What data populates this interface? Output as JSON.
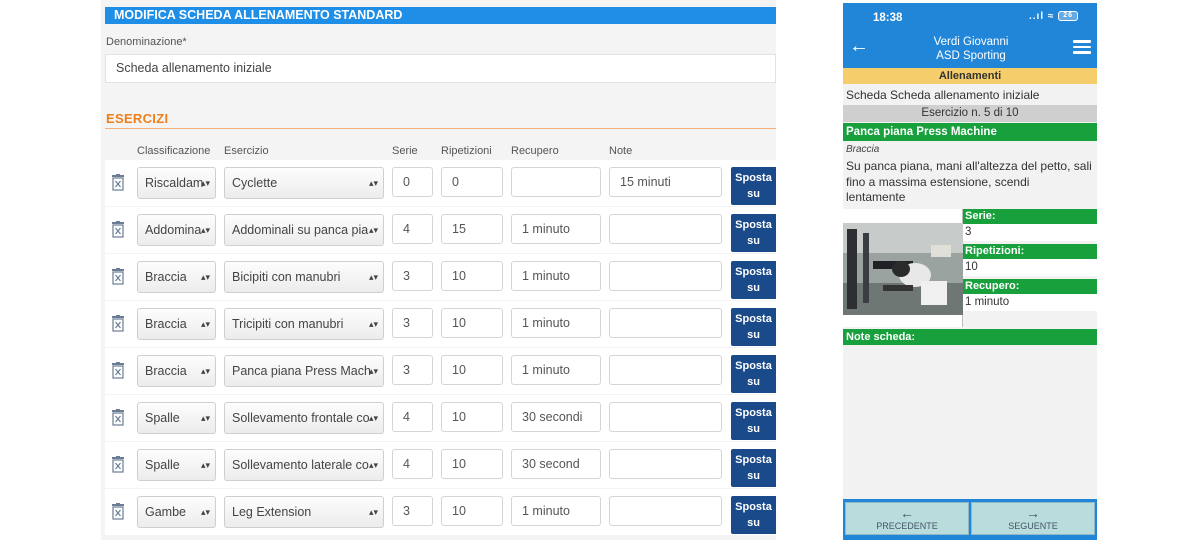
{
  "form": {
    "title": "MODIFICA SCHEDA ALLENAMENTO STANDARD",
    "name_label": "Denominazione*",
    "name_value": "Scheda allenamento iniziale",
    "section_title": "ESERCIZI",
    "columns": {
      "classification": "Classificazione",
      "exercise": "Esercizio",
      "sets": "Serie",
      "reps": "Ripetizioni",
      "rest": "Recupero",
      "notes": "Note"
    },
    "move_up_label_1": "Sposta",
    "move_up_label_2": "su",
    "rows": [
      {
        "classification": "Riscaldam",
        "exercise": "Cyclette",
        "sets": "0",
        "reps": "0",
        "rest": "",
        "notes": "15 minuti"
      },
      {
        "classification": "Addomina",
        "exercise": "Addominali su panca pia",
        "sets": "4",
        "reps": "15",
        "rest": "1 minuto",
        "notes": ""
      },
      {
        "classification": "Braccia",
        "exercise": "Bicipiti con manubri",
        "sets": "3",
        "reps": "10",
        "rest": "1 minuto",
        "notes": ""
      },
      {
        "classification": "Braccia",
        "exercise": "Tricipiti con manubri",
        "sets": "3",
        "reps": "10",
        "rest": "1 minuto",
        "notes": ""
      },
      {
        "classification": "Braccia",
        "exercise": "Panca piana Press Mach",
        "sets": "3",
        "reps": "10",
        "rest": "1 minuto",
        "notes": ""
      },
      {
        "classification": "Spalle",
        "exercise": "Sollevamento frontale co",
        "sets": "4",
        "reps": "10",
        "rest": "30 secondi",
        "notes": ""
      },
      {
        "classification": "Spalle",
        "exercise": "Sollevamento laterale co",
        "sets": "4",
        "reps": "10",
        "rest": "30 second",
        "notes": ""
      },
      {
        "classification": "Gambe",
        "exercise": "Leg Extension",
        "sets": "3",
        "reps": "10",
        "rest": "1 minuto",
        "notes": ""
      }
    ]
  },
  "phone": {
    "time": "18:38",
    "signal": "..ıl ≈",
    "battery": "26",
    "user_name": "Verdi Giovanni",
    "club": "ASD Sporting",
    "section": "Allenamenti",
    "plan_title": "Scheda Scheda allenamento iniziale",
    "exercise_count": "Esercizio n. 5 di 10",
    "exercise_name": "Panca piana Press Machine",
    "category": "Braccia",
    "description": "Su panca piana, mani all'altezza del petto, sali fino a massima estensione, scendi lentamente",
    "sets_label": "Serie:",
    "sets_value": "3",
    "reps_label": "Ripetizioni:",
    "reps_value": "10",
    "rest_label": "Recupero:",
    "rest_value": "1 minuto",
    "notes_label": "Note scheda:",
    "prev_label": "PRECEDENTE",
    "next_label": "SEGUENTE",
    "prev_arrow": "←",
    "next_arrow": "→",
    "back_arrow": "←"
  },
  "colors": {
    "title_bar": "#1e8ee6",
    "section_accent": "#f07f1a",
    "move_button": "#1a4a8a",
    "phone_header": "#2186d8",
    "phone_green": "#17a03c",
    "phone_section": "#f5cd6a"
  }
}
